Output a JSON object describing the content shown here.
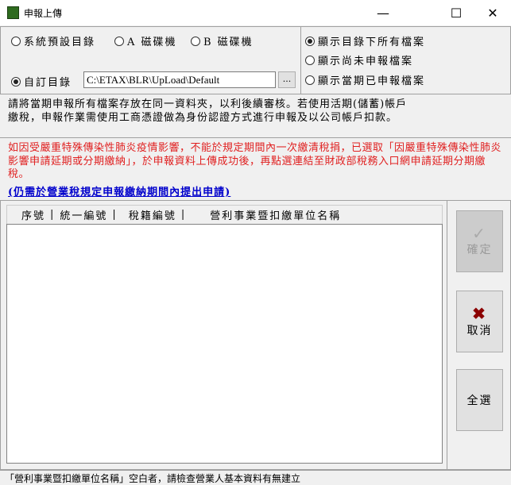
{
  "window": {
    "title": "申報上傳",
    "minimize": "—",
    "maximize": "☐",
    "close": "✕"
  },
  "source": {
    "options": [
      "系統預設目錄",
      "A 磁碟機",
      "B 磁碟機",
      "自訂目錄"
    ],
    "selected": "自訂目錄",
    "path": "C:\\ETAX\\BLR\\UpLoad\\Default",
    "browse_label": "..."
  },
  "filter": {
    "options": [
      "顯示目錄下所有檔案",
      "顯示尚未申報檔案",
      "顯示當期已申報檔案"
    ],
    "selected": "顯示目錄下所有檔案"
  },
  "info": {
    "line1": "請將當期申報所有檔案存放在同一資料夾，以利後續審核。若使用活期(儲蓄)帳戶",
    "line2": "繳稅，申報作業需使用工商憑證做為身份認證方式進行申報及以公司帳戶扣款。"
  },
  "notice": {
    "text": "如因受嚴重特殊傳染性肺炎疫情影響，不能於規定期間內一次繳清稅捐，已選取「因嚴重特殊傳染性肺炎影響申請延期或分期繳納」，於申報資料上傳成功後，再點選連結至財政部稅務入口網申請延期分期繳稅。",
    "link": "(仍需於營業稅規定申報繳納期間內提出申請)"
  },
  "list": {
    "columns": [
      "序號",
      "統一編號",
      "稅籍編號",
      "營利事業暨扣繳單位名稱"
    ],
    "rows": []
  },
  "buttons": {
    "confirm": "確定",
    "cancel": "取消",
    "select_all": "全選"
  },
  "status": "「營利事業暨扣繳單位名稱」空白者，請檢查營業人基本資料有無建立"
}
